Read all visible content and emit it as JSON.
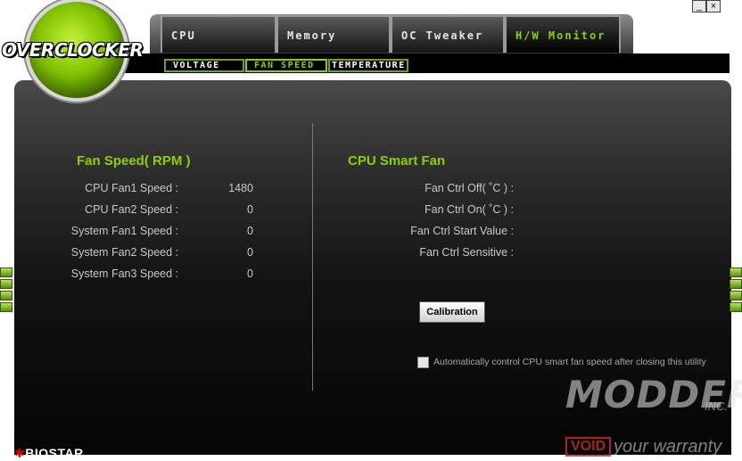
{
  "app": {
    "logo_text": "OVERCLOCKER",
    "brand": "BIOSTAR",
    "window_controls": {
      "minimize": "_",
      "close": "×"
    }
  },
  "main_tabs": [
    {
      "label": "CPU",
      "active": false
    },
    {
      "label": "Memory",
      "active": false
    },
    {
      "label": "OC Tweaker",
      "active": false
    },
    {
      "label": "H/W Monitor",
      "active": true
    }
  ],
  "sub_tabs": [
    {
      "label": "VOLTAGE",
      "active": false
    },
    {
      "label": "FAN SPEED",
      "active": true
    },
    {
      "label": "TEMPERATURE",
      "active": false
    }
  ],
  "fan_speed": {
    "title": "Fan Speed( RPM )",
    "rows": [
      {
        "label": "CPU Fan1 Speed :",
        "value": "1480"
      },
      {
        "label": "CPU Fan2 Speed :",
        "value": "0"
      },
      {
        "label": "System Fan1 Speed :",
        "value": "0"
      },
      {
        "label": "System Fan2 Speed :",
        "value": "0"
      },
      {
        "label": "System Fan3 Speed :",
        "value": "0"
      }
    ]
  },
  "smart_fan": {
    "title": "CPU Smart Fan",
    "rows": [
      {
        "label": "Fan Ctrl Off( ˚C ) :"
      },
      {
        "label": "Fan Ctrl On( ˚C ) :"
      },
      {
        "label": "Fan Ctrl Start Value :"
      },
      {
        "label": "Fan Ctrl Sensitive :"
      }
    ],
    "calibration_label": "Calibration",
    "auto_control_label": "Automatically control CPU smart fan speed after closing this utility",
    "auto_control_checked": false
  },
  "watermark": {
    "main": "MODDERS",
    "inc": "INC.",
    "void": "VOID",
    "warranty": "your warranty"
  },
  "colors": {
    "accent_green": "#8cd000",
    "panel_dark": "#050505"
  }
}
